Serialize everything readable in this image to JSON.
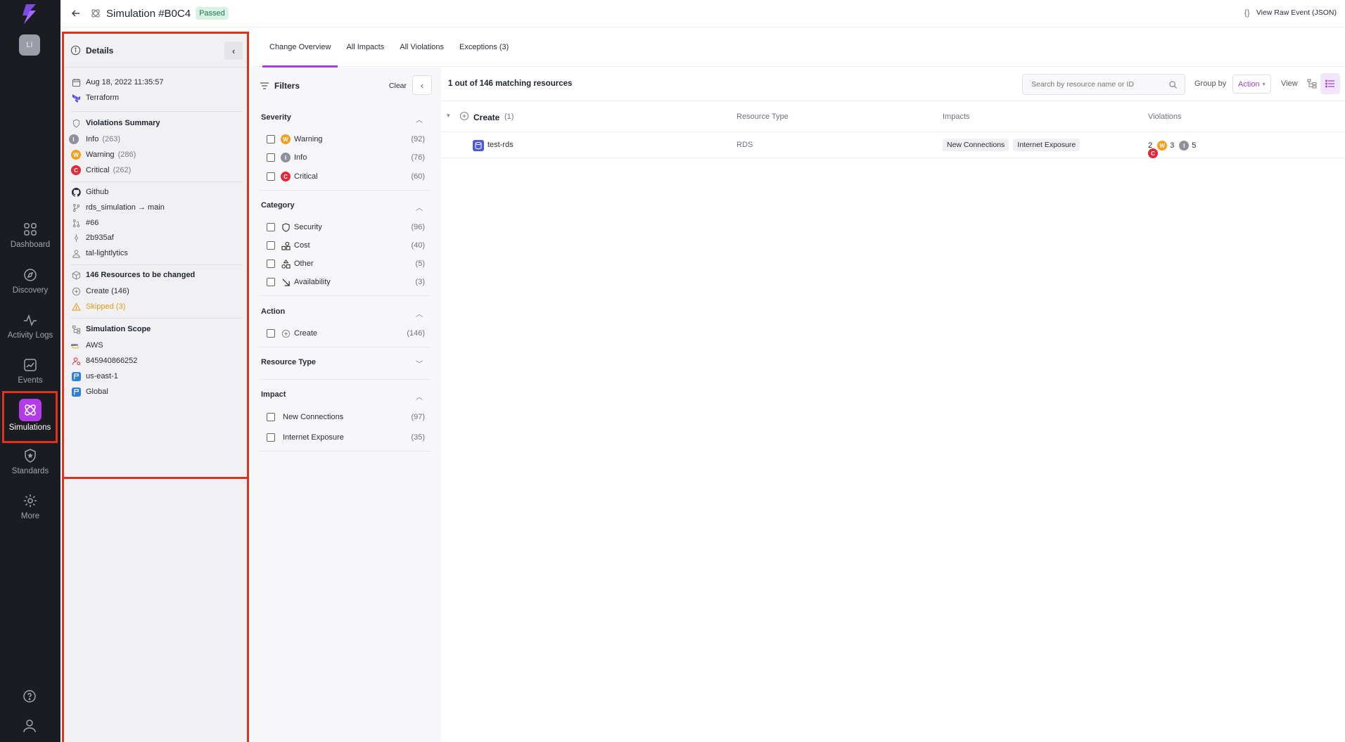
{
  "nav": {
    "avatar": "LI",
    "items": [
      {
        "label": "Dashboard",
        "icon": "dashboard-icon"
      },
      {
        "label": "Discovery",
        "icon": "compass-icon"
      },
      {
        "label": "Activity Logs",
        "icon": "activity-icon"
      },
      {
        "label": "Events",
        "icon": "events-icon"
      },
      {
        "label": "Simulations",
        "icon": "simulations-icon"
      },
      {
        "label": "Standards",
        "icon": "shield-star-icon"
      },
      {
        "label": "More",
        "icon": "gear-icon"
      }
    ]
  },
  "header": {
    "title": "Simulation #B0C4",
    "status": "Passed",
    "raw_event": "View Raw Event (JSON)",
    "raw_icon": "{}"
  },
  "details": {
    "title": "Details",
    "date": "Aug 18, 2022 11:35:57",
    "tool": "Terraform",
    "violations_title": "Violations Summary",
    "violations": [
      {
        "letter": "I",
        "label": "Info",
        "count": "(263)"
      },
      {
        "letter": "W",
        "label": "Warning",
        "count": "(286)"
      },
      {
        "letter": "C",
        "label": "Critical",
        "count": "(262)"
      }
    ],
    "vcs": "Github",
    "branch": "rds_simulation → main",
    "pr": "#66",
    "commit": "2b935af",
    "user": "tal-lightlytics",
    "resources_title": "146 Resources to be changed",
    "create": "Create (146)",
    "skipped": "Skipped (3)",
    "scope_title": "Simulation Scope",
    "cloud": "AWS",
    "account": "845940866252",
    "region": "us-east-1",
    "global": "Global"
  },
  "tabs": [
    "Change Overview",
    "All Impacts",
    "All Violations",
    "Exceptions (3)"
  ],
  "filters": {
    "title": "Filters",
    "clear": "Clear",
    "severity": {
      "title": "Severity",
      "items": [
        {
          "letter": "W",
          "label": "Warning",
          "count": "(92)"
        },
        {
          "letter": "I",
          "label": "Info",
          "count": "(76)"
        },
        {
          "letter": "C",
          "label": "Critical",
          "count": "(60)"
        }
      ]
    },
    "category": {
      "title": "Category",
      "items": [
        {
          "label": "Security",
          "count": "(96)"
        },
        {
          "label": "Cost",
          "count": "(40)"
        },
        {
          "label": "Other",
          "count": "(5)"
        },
        {
          "label": "Availability",
          "count": "(3)"
        }
      ]
    },
    "action": {
      "title": "Action",
      "items": [
        {
          "label": "Create",
          "count": "(146)"
        }
      ]
    },
    "resource_type": {
      "title": "Resource Type"
    },
    "impact": {
      "title": "Impact",
      "items": [
        {
          "label": "New Connections",
          "count": "(97)"
        },
        {
          "label": "Internet Exposure",
          "count": "(35)"
        }
      ]
    }
  },
  "main": {
    "count_text": "1 out of 146 matching resources",
    "search_placeholder": "Search by resource name or ID",
    "group_by_label": "Group by",
    "group_by_value": "Action",
    "view_label": "View",
    "columns": {
      "resource_type": "Resource Type",
      "impacts": "Impacts",
      "violations": "Violations"
    },
    "group": {
      "label": "Create",
      "count": "(1)"
    },
    "rows": [
      {
        "name": "test-rds",
        "type": "RDS",
        "impacts": [
          "New Connections",
          "Internet Exposure"
        ],
        "violations": {
          "critical": "2",
          "warning": "3",
          "info": "5"
        }
      }
    ]
  },
  "colors": {
    "accent": "#a63fd8",
    "critical": "#e2283b",
    "warning": "#f2a01d",
    "info": "#8f929c",
    "passed_bg": "#d8f3e6",
    "highlight": "#e1301c"
  }
}
